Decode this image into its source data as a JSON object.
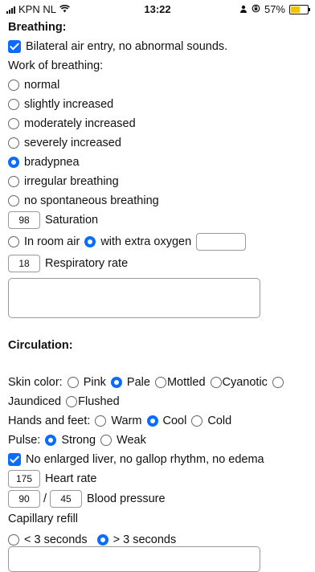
{
  "status_bar": {
    "carrier": "KPN NL",
    "time": "13:22",
    "battery": "57%"
  },
  "breathing": {
    "title": "Breathing:",
    "air_entry_label": "Bilateral air entry, no abnormal sounds.",
    "work_title": "Work of breathing:",
    "options": [
      "normal",
      "slightly increased",
      "moderately increased",
      "severely increased",
      "bradypnea",
      "irregular breathing",
      "no spontaneous breathing"
    ],
    "selected": "bradypnea",
    "saturation_value": "98",
    "saturation_label": "Saturation",
    "room_air_label": "In room air",
    "oxygen_label": "with extra oxygen",
    "resp_rate_value": "18",
    "resp_rate_label": "Respiratory rate"
  },
  "circulation": {
    "title": "Circulation:",
    "skin_label": "Skin color:",
    "skin_options": [
      "Pink",
      "Pale",
      "Mottled",
      "Cyanotic",
      "Jaundiced",
      "Flushed"
    ],
    "skin_selected": "Pale",
    "hands_label": "Hands and feet:",
    "hands_options": [
      "Warm",
      "Cool",
      "Cold"
    ],
    "hands_selected": "Cool",
    "pulse_label": "Pulse:",
    "pulse_options": [
      "Strong",
      "Weak"
    ],
    "pulse_selected": "Strong",
    "liver_label": "No enlarged liver, no gallop rhythm, no edema",
    "heart_rate_value": "175",
    "heart_rate_label": "Heart rate",
    "bp_sys": "90",
    "bp_dia": "45",
    "bp_label": "Blood pressure",
    "cap_refill_label": "Capillary refill",
    "cap_options": [
      "< 3 seconds",
      "> 3 seconds"
    ],
    "cap_selected": "> 3 seconds"
  }
}
